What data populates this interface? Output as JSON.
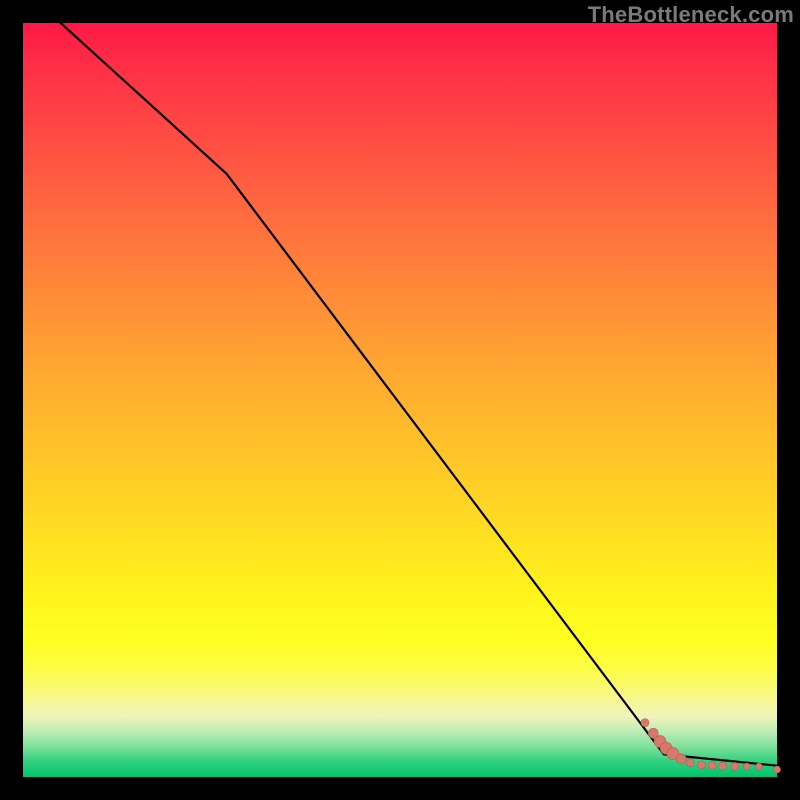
{
  "watermark": "TheBottleneck.com",
  "colors": {
    "curve": "#000000",
    "marker_fill": "#d6786b",
    "marker_stroke": "#b95b50"
  },
  "chart_data": {
    "type": "line",
    "title": "",
    "xlabel": "",
    "ylabel": "",
    "xlim": [
      0,
      100
    ],
    "ylim": [
      0,
      100
    ],
    "grid": false,
    "legend": false,
    "series": [
      {
        "name": "curve",
        "x": [
          5,
          27,
          85,
          100
        ],
        "y": [
          100,
          80,
          3,
          1.5
        ]
      }
    ],
    "scatter": {
      "name": "markers",
      "points": [
        {
          "x": 82.5,
          "y": 7.2,
          "r": 4
        },
        {
          "x": 83.6,
          "y": 5.8,
          "r": 5
        },
        {
          "x": 84.5,
          "y": 4.7,
          "r": 6
        },
        {
          "x": 85.3,
          "y": 3.8,
          "r": 6
        },
        {
          "x": 86.2,
          "y": 3.1,
          "r": 6
        },
        {
          "x": 87.3,
          "y": 2.4,
          "r": 5
        },
        {
          "x": 88.5,
          "y": 1.9,
          "r": 4
        },
        {
          "x": 90.0,
          "y": 1.6,
          "r": 4
        },
        {
          "x": 91.4,
          "y": 1.5,
          "r": 4
        },
        {
          "x": 92.8,
          "y": 1.45,
          "r": 4
        },
        {
          "x": 94.4,
          "y": 1.4,
          "r": 4
        },
        {
          "x": 96.0,
          "y": 1.38,
          "r": 3.5
        },
        {
          "x": 97.6,
          "y": 1.36,
          "r": 3.5
        },
        {
          "x": 100.0,
          "y": 1.0,
          "r": 3.5
        }
      ]
    }
  }
}
